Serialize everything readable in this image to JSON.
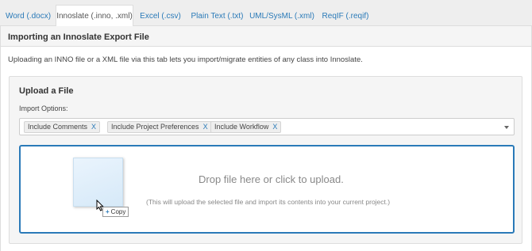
{
  "tabs": [
    {
      "label": "Word (.docx)",
      "active": false
    },
    {
      "label": "Innoslate (.inno, .xml)",
      "active": true
    },
    {
      "label": "Excel (.csv)",
      "active": false
    },
    {
      "label": "Plain Text (.txt)",
      "active": false
    },
    {
      "label": "UML/SysML (.xml)",
      "active": false
    },
    {
      "label": "ReqIF (.reqif)",
      "active": false
    }
  ],
  "panel": {
    "title": "Importing an Innoslate Export File",
    "intro": "Uploading an INNO file or a XML file via this tab lets you import/migrate entities of any class into Innoslate."
  },
  "upload": {
    "title": "Upload a File",
    "options_label": "Import Options:",
    "chips": [
      {
        "label": "Include Comments",
        "remove": "X"
      },
      {
        "label": "Include Project Preferences",
        "remove": "X"
      },
      {
        "label": "Include Workflow",
        "remove": "X"
      }
    ],
    "dropzone": {
      "main_text": "Drop file here or click to upload.",
      "sub_text": "(This will upload the selected file and import its contents into your current project.)"
    },
    "drag_cursor": {
      "plus": "+",
      "label": "Copy"
    }
  },
  "colors": {
    "accent": "#2a7ab8",
    "tabbar_bg": "#eeeeee",
    "panel_bg": "#f5f5f5"
  }
}
